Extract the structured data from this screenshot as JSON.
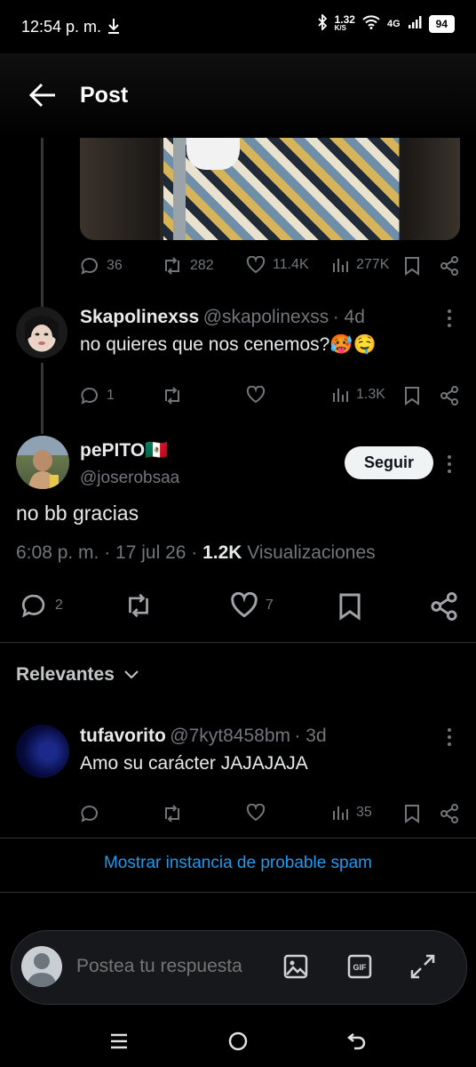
{
  "status_bar": {
    "time": "12:54 p. m.",
    "speed_top": "1.32",
    "speed_bottom": "K/S",
    "network": "4G",
    "battery": "94"
  },
  "header": {
    "title": "Post"
  },
  "parent_tweet_actions": {
    "replies": "36",
    "reposts": "282",
    "likes": "11.4K",
    "views": "277K"
  },
  "reply1": {
    "name": "Skapolinexss",
    "handle": "@skapolinexss",
    "time": "· 4d",
    "text": "no quieres que nos cenemos?🥵🤤",
    "replies": "1",
    "views": "1.3K"
  },
  "main_tweet": {
    "name": "pePITO🇲🇽",
    "handle": "@joserobsaa",
    "follow_label": "Seguir",
    "text": "no bb gracias",
    "time": "6:08 p. m. · 17 jul 26 · ",
    "views_count": "1.2K",
    "views_label": " Visualizaciones",
    "replies": "2",
    "likes": "7"
  },
  "sort": {
    "label": "Relevantes"
  },
  "reply2": {
    "name": "tufavorito",
    "handle": "@7kyt8458bm",
    "time": "· 3d",
    "text": "Amo su carácter JAJAJAJA",
    "views": "35"
  },
  "spam_link": "Mostrar instancia de probable spam",
  "composer": {
    "placeholder": "Postea tu respuesta"
  },
  "colors": {
    "accent": "#1d9bf0",
    "background": "#000000",
    "muted": "#71767b"
  }
}
